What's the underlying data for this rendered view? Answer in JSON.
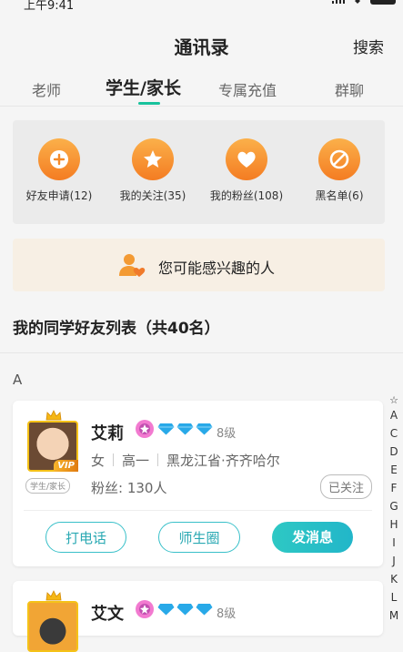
{
  "status_bar": {
    "time": "上午9:41"
  },
  "header": {
    "title": "通讯录",
    "search_label": "搜索"
  },
  "tabs": [
    {
      "label": "老师"
    },
    {
      "label": "学生/家长"
    },
    {
      "label": "专属充值"
    },
    {
      "label": "群聊"
    }
  ],
  "active_tab": 1,
  "quick_actions": [
    {
      "label": "好友申请(12)",
      "icon": "plus-icon"
    },
    {
      "label": "我的关注(35)",
      "icon": "star-icon"
    },
    {
      "label": "我的粉丝(108)",
      "icon": "heart-icon"
    },
    {
      "label": "黑名单(6)",
      "icon": "block-icon"
    }
  ],
  "interest": {
    "label": "您可能感兴趣的人",
    "icon": "users-icon"
  },
  "section": {
    "title": "我的同学好友列表（共40名）",
    "letter": "A"
  },
  "contacts": [
    {
      "name": "艾莉",
      "level": "8级",
      "vip": "VIP",
      "role": "学生/家长",
      "gender": "女",
      "grade": "高一",
      "location": "黑龙江省·齐齐哈尔",
      "fans": "粉丝: 130人",
      "follow_status": "已关注",
      "actions": {
        "call": "打电话",
        "circle": "师生圈",
        "message": "发消息"
      }
    },
    {
      "name": "艾文",
      "level": "8级"
    }
  ],
  "index_bar": [
    "☆",
    "A",
    "C",
    "D",
    "E",
    "F",
    "G",
    "H",
    "I",
    "J",
    "K",
    "L",
    "M"
  ],
  "colors": {
    "accent": "#18c29c",
    "orange": "#f47c22",
    "teal": "#2ec8c4"
  }
}
